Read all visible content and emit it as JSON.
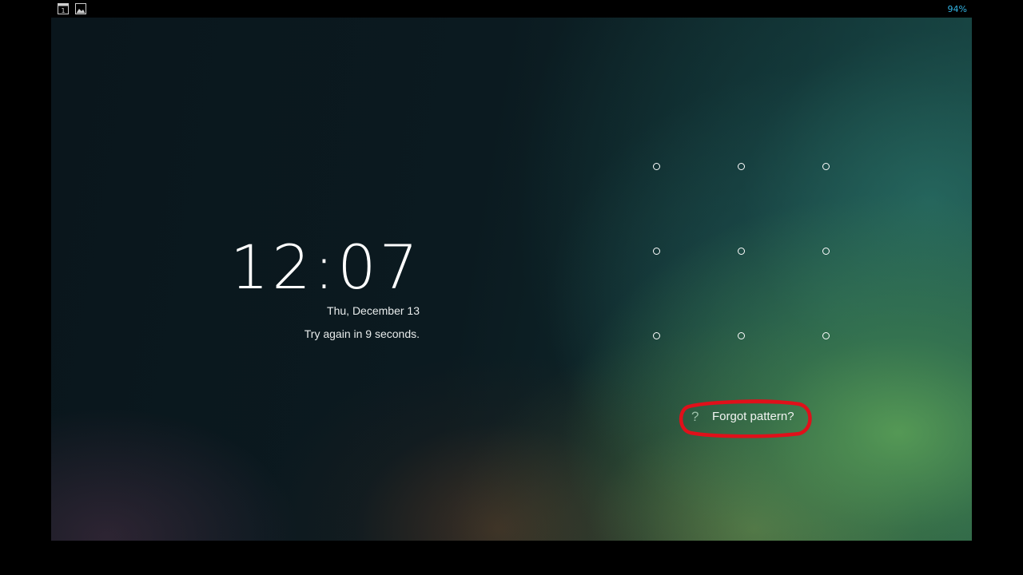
{
  "status_bar": {
    "left_icons": [
      "calendar-icon",
      "gallery-image-icon"
    ],
    "calendar_icon_digit": "1",
    "battery_text": "94%"
  },
  "lockscreen": {
    "time": "12:07",
    "date": "Thu, December 13",
    "message": "Try again in 9 seconds."
  },
  "pattern": {
    "rows": 3,
    "cols": 3
  },
  "forgot": {
    "icon": "question-mark-icon",
    "icon_glyph": "?",
    "label": "Forgot pattern?",
    "highlight_color": "#e0101a"
  },
  "colors": {
    "status_accent": "#33b5e5"
  }
}
